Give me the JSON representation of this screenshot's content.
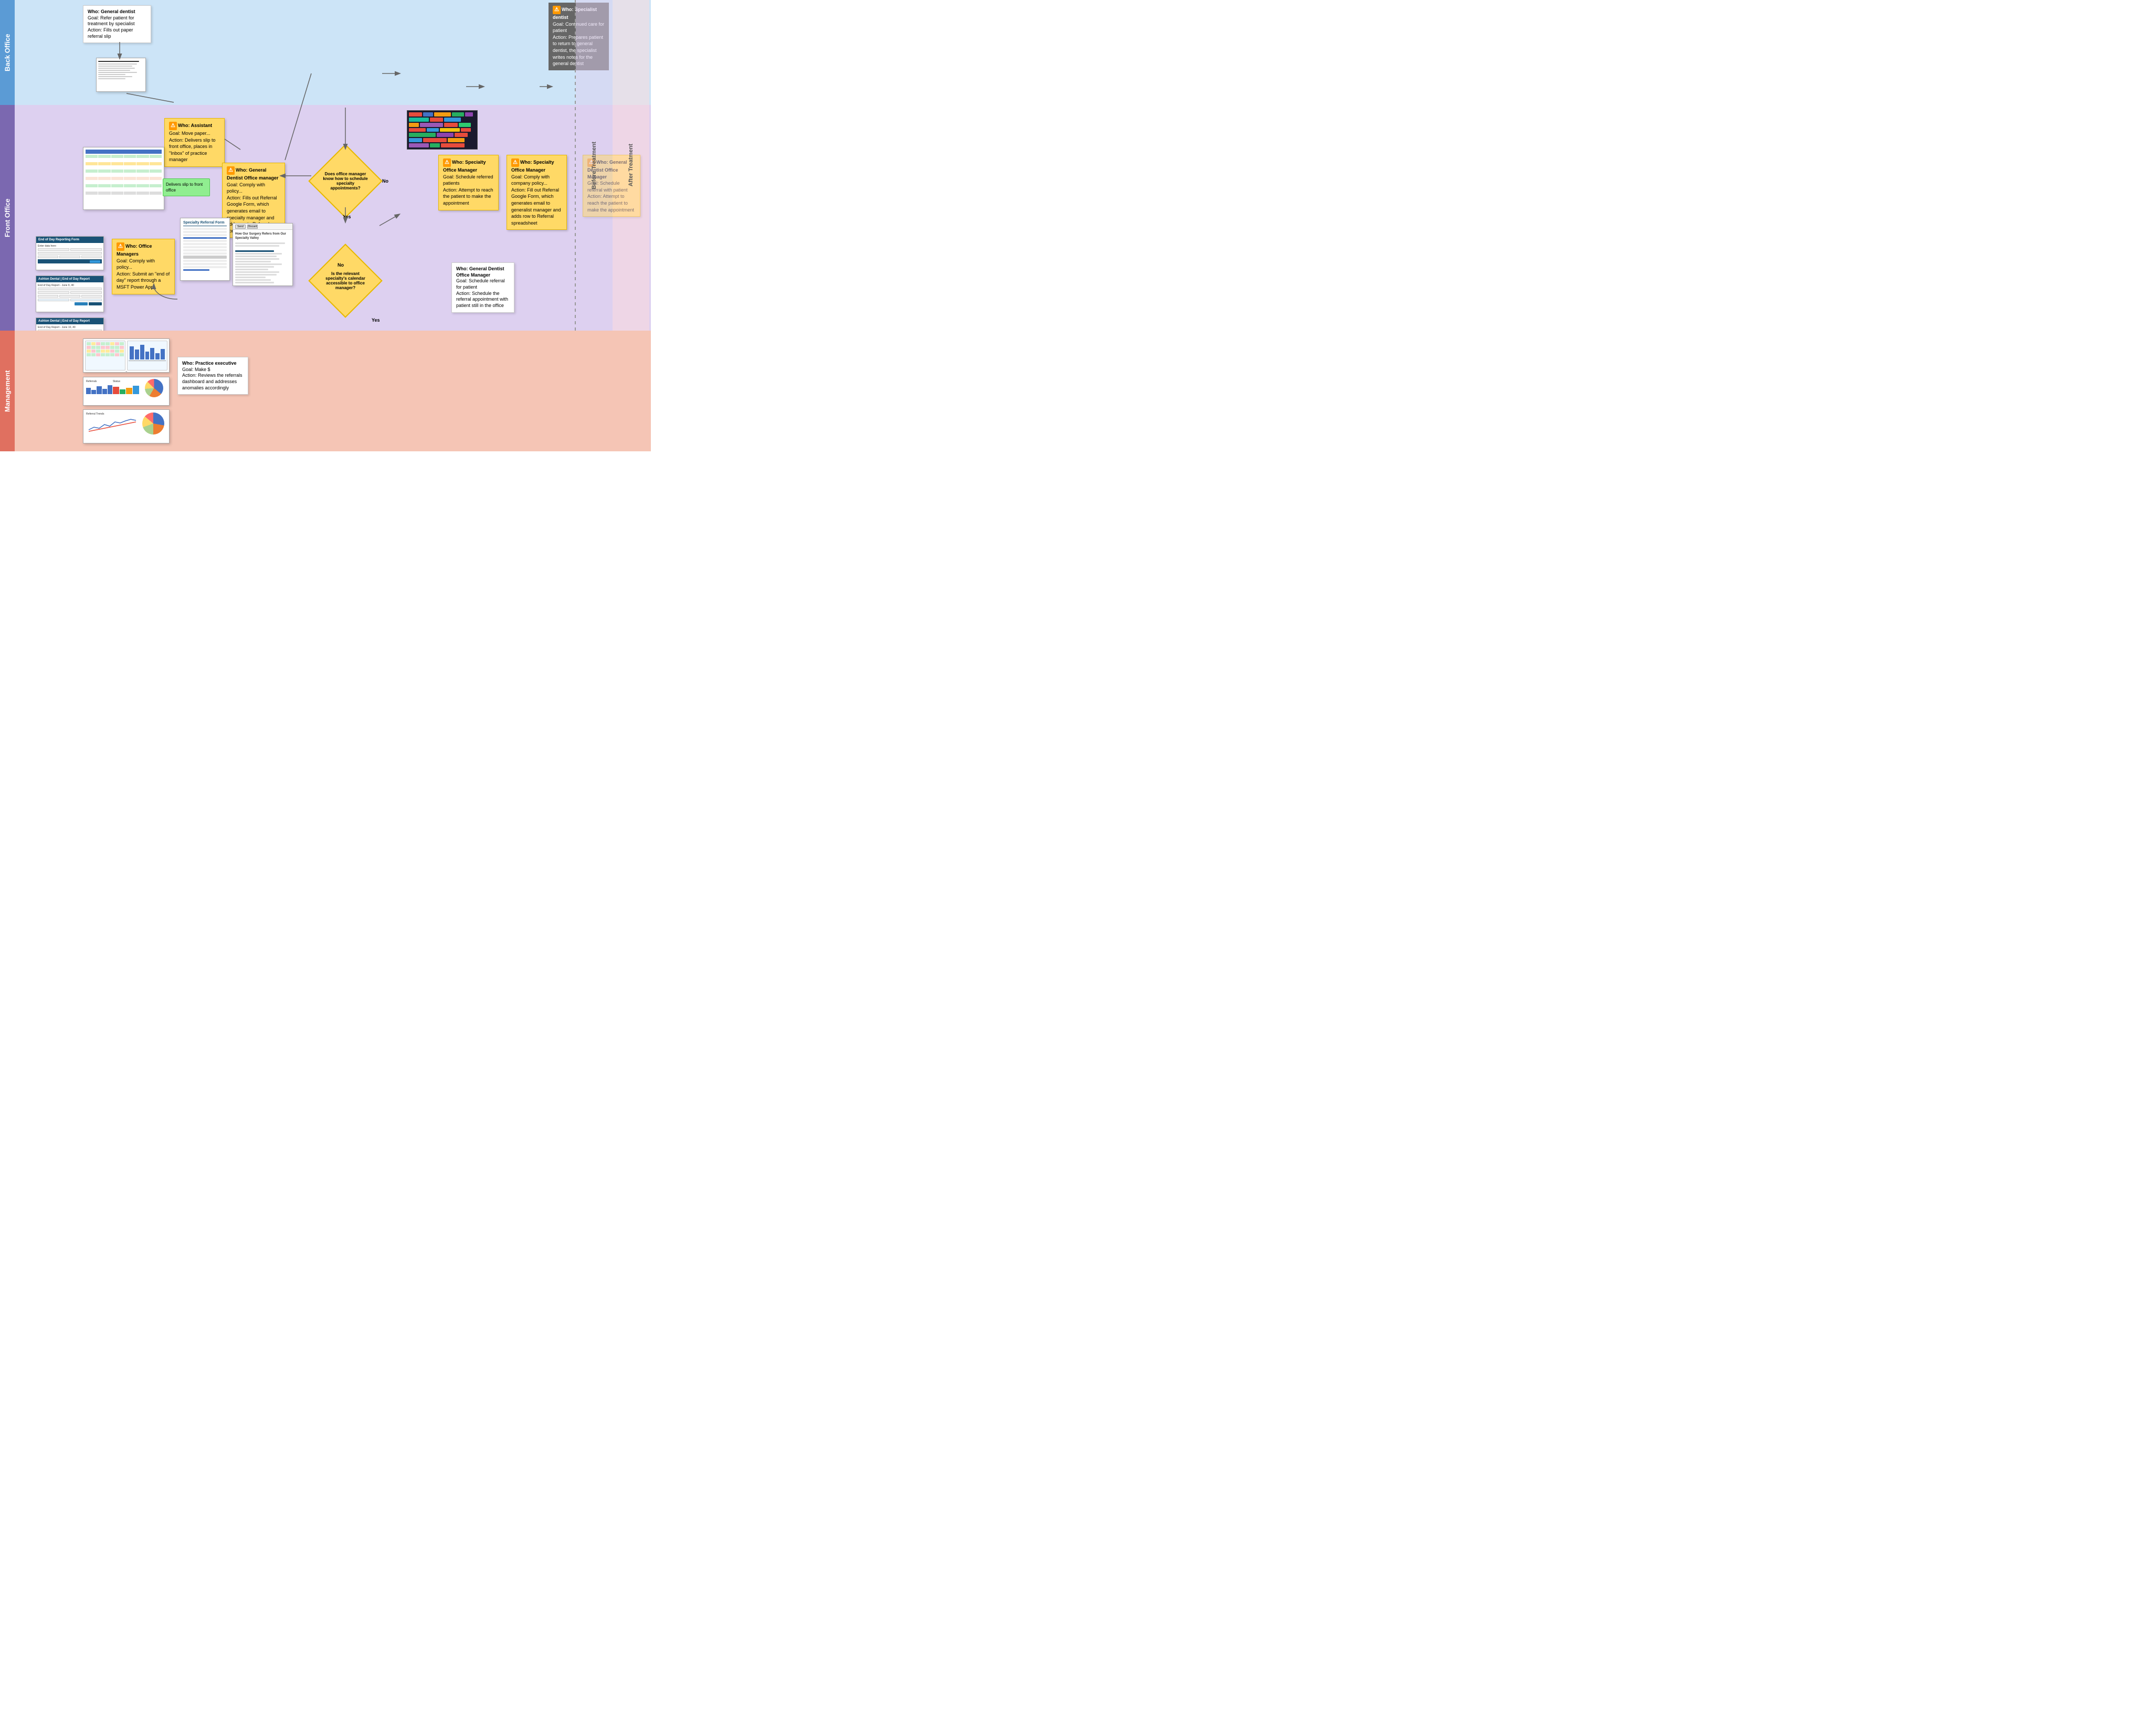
{
  "lanes": {
    "back_office": {
      "label": "Back Office",
      "color": "#5b9bd5",
      "bg": "#cce4f7"
    },
    "front_office": {
      "label": "Front Office",
      "color": "#7b68b0",
      "bg": "#ddd0f0"
    },
    "management": {
      "label": "Management",
      "color": "#e07060",
      "bg": "#f5c5b5"
    }
  },
  "phases": {
    "before": "Before Treatment",
    "after": "After Treatment"
  },
  "notes": {
    "general_dentist": {
      "who": "Who: General dentist",
      "goal": "Goal: Refer patient for treatment by specialist",
      "action": "Action: Fills out paper referral slip"
    },
    "assistant": {
      "who": "Who: Assistant",
      "goal": "Goal: Move paper...",
      "action": "Action: Delivers slip to front office, places in \"Inbox\" of practice manager"
    },
    "gd_office_manager": {
      "who": "Who: General Dentist Office manager",
      "goal": "Goal: Comply with policy...",
      "action": "Action: Fills out Referral Google Form, which generates email to specialty manager and adds row to Referral spreadsheet"
    },
    "office_managers": {
      "who": "Who: Office Managers",
      "goal": "Goal: Comply with policy...",
      "action": "Action: Submit an \"end of day\" report through a MSFT Power App"
    },
    "specialty_office_manager_before": {
      "who": "Who: Specialty Office Manager",
      "goal": "Goal: Schedule referred patients",
      "action": "Action: Attempt to reach the patient to make the appointment"
    },
    "specialty_office_manager_after": {
      "who": "Who: Specialty Office Manager",
      "goal": "Goal: Comply with company policy...",
      "action": "Action: Fill out Referral Google Form, which generates email to generalist manager and adds row to Referral spreadsheet"
    },
    "specialist_dentist": {
      "who": "Who: Specialist dentist",
      "goal": "Goal: Continued care for patient",
      "action": "Action: Prepares patient to return to general dentist, the specialist writes notes for the general dentist"
    },
    "gd_office_manager_after": {
      "who": "Who: General Dentist Office Manager",
      "goal": "Goal: Schedule referral with patient",
      "action": "Action: Attempt to reach the patient to make the appointment"
    },
    "practice_executive": {
      "who": "Who: Practice executive",
      "goal": "Goal: Make $",
      "action": "Action: Reviews the referrals dashboard and addresses anomalies accordingly"
    }
  },
  "decisions": {
    "office_manager_knows": "Does office manager know how to schedule specialty appointments?",
    "calendar_accessible": "Is the relevant specialty's calendar accessible to office manager?"
  },
  "decision_outcomes": {
    "no1": "No",
    "yes1": "Yes",
    "no2": "No",
    "yes2": "Yes"
  },
  "sub_notes": {
    "gd_om_schedule": {
      "who": "Who: General Dentist Office Manager",
      "goal": "Goal: Schedule referral for patient",
      "action": "Action: Schedule the referral appointment with patient still in the office"
    }
  },
  "doc_labels": {
    "paper_referral": "Paper Referral Slip",
    "spreadsheet": "Referral Spreadsheet",
    "referral_form": "Specialty Referral Form",
    "email_form": "Email Form",
    "end_of_day_form": "End of Day Reporting Form",
    "end_of_day_report1": "Ashton Dental | End of Day Report",
    "end_of_day_report2": "Ashton Dental | End of Day Report",
    "dashboard": "Referrals Dashboard"
  }
}
